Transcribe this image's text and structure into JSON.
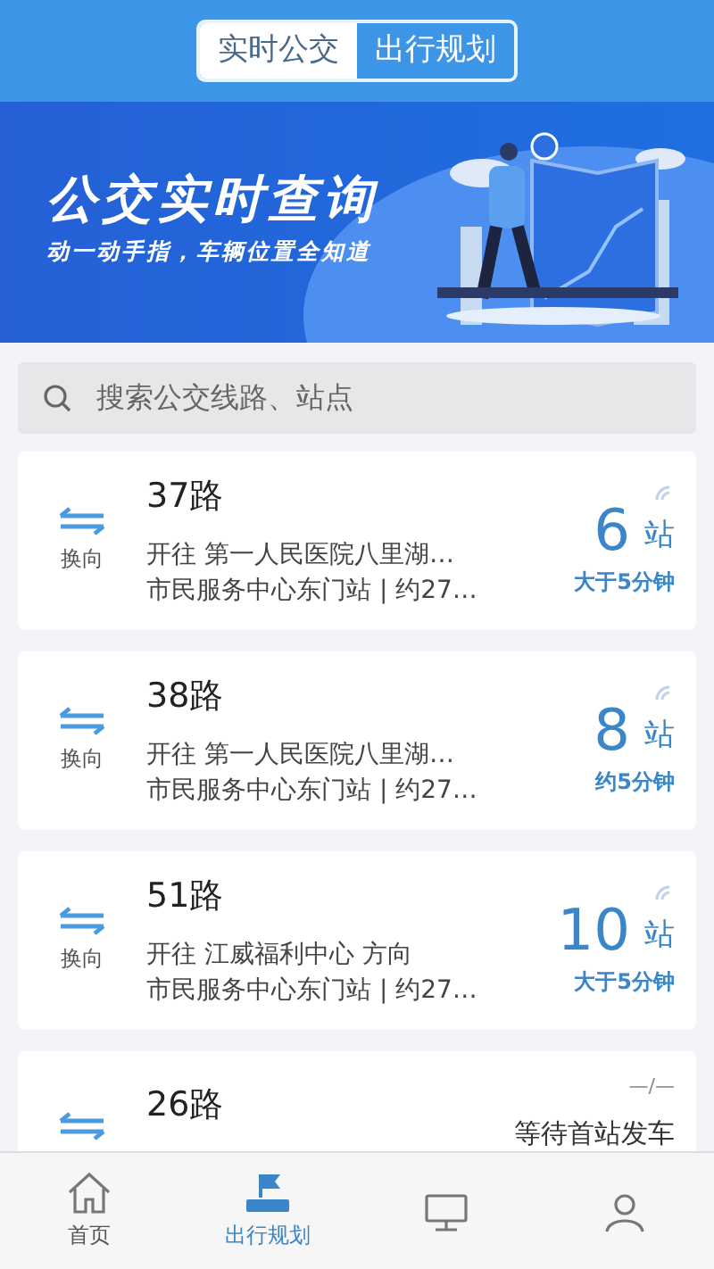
{
  "segments": [
    {
      "label": "实时公交",
      "selected": true
    },
    {
      "label": "出行规划",
      "selected": false
    }
  ],
  "banner": {
    "title": "公交实时查询",
    "subtitle": "动一动手指，车辆位置全知道"
  },
  "search": {
    "placeholder": "搜索公交线路、站点"
  },
  "routes": [
    {
      "swap_label": "换向",
      "name": "37路",
      "direction": "开往 第一人民医院八里湖…",
      "station": "市民服务中心东门站 | 约27…",
      "kind": "eta",
      "stops": "6",
      "unit": "站",
      "eta": "大于5分钟"
    },
    {
      "swap_label": "换向",
      "name": "38路",
      "direction": "开往 第一人民医院八里湖…",
      "station": "市民服务中心东门站 | 约27…",
      "kind": "eta",
      "stops": "8",
      "unit": "站",
      "eta": "约5分钟"
    },
    {
      "swap_label": "换向",
      "name": "51路",
      "direction": "开往 江威福利中心 方向",
      "station": "市民服务中心东门站 | 约27…",
      "kind": "eta",
      "stops": "10",
      "unit": "站",
      "eta": "大于5分钟"
    },
    {
      "name": "26路",
      "kind": "waiting",
      "placeholder_value": "—/—",
      "status": "等待首站发车"
    }
  ],
  "tabbar": [
    {
      "kind": "home",
      "label": "首页",
      "selected": false
    },
    {
      "kind": "flag",
      "label": "出行规划",
      "selected": true
    },
    {
      "kind": "monitor",
      "selected": false
    },
    {
      "kind": "person",
      "selected": false
    }
  ]
}
